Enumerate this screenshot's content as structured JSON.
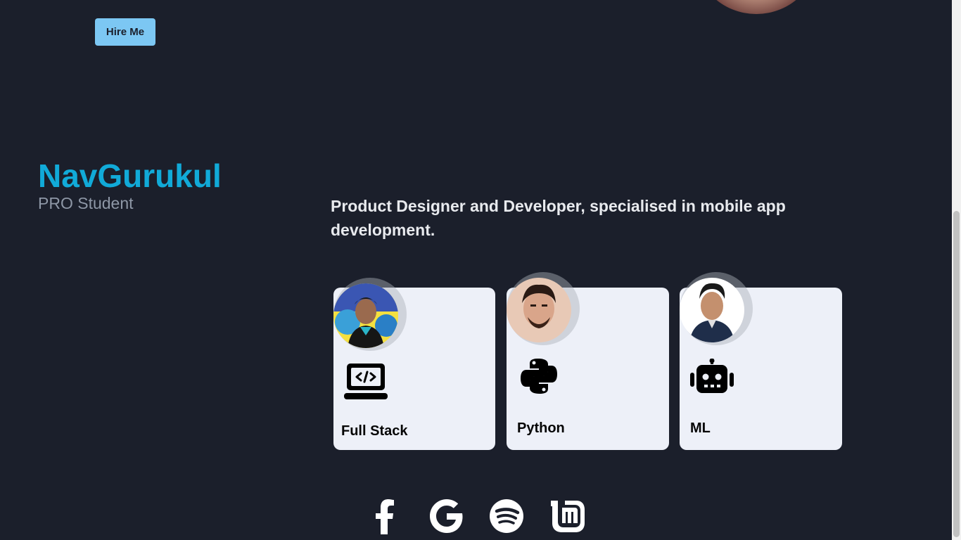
{
  "header": {
    "hire_button": "Hire Me"
  },
  "intro": {
    "brand": "NavGurukul",
    "subtitle": "PRO Student",
    "tagline": "Product Designer and Developer, specialised in mobile app development."
  },
  "skills": [
    {
      "label": "Full Stack",
      "icon": "laptop-code-icon"
    },
    {
      "label": "Python",
      "icon": "python-icon"
    },
    {
      "label": "ML",
      "icon": "robot-icon"
    }
  ],
  "social": [
    {
      "name": "facebook-icon"
    },
    {
      "name": "google-icon"
    },
    {
      "name": "spotify-icon"
    },
    {
      "name": "linux-mint-icon"
    }
  ],
  "colors": {
    "background": "#1b1f2b",
    "accent": "#11aad8",
    "button": "#7cc7f3",
    "card": "#edf0f8"
  }
}
